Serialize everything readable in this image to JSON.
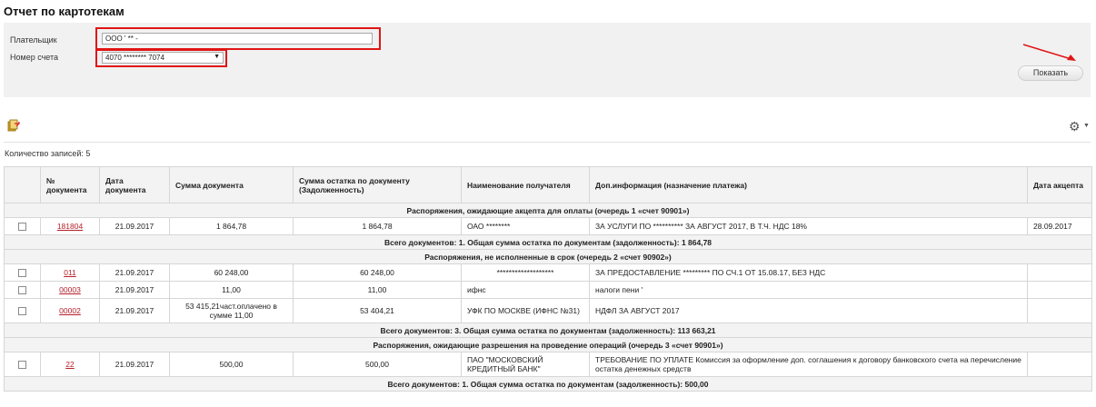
{
  "page": {
    "title": "Отчет по картотекам"
  },
  "filters": {
    "payer_label": "Плательщик",
    "payer_value": "ООО '  ** -",
    "account_label": "Номер счета",
    "account_value": "4070 ********    7074",
    "show_button": "Показать"
  },
  "toolbar": {
    "export_icon": "export-icon",
    "settings_icon": "gear-icon"
  },
  "record_count": "Количество записей: 5",
  "table": {
    "headers": [
      "",
      "№ документа",
      "Дата документа",
      "Сумма документа",
      "Сумма остатка по документу (Задолженность)",
      "Наименование получателя",
      "Доп.информация (назначение платежа)",
      "Дата акцепта"
    ],
    "groups": [
      {
        "title": "Распоряжения, ожидающие акцепта для оплаты (очередь 1 «счет 90901»)",
        "rows": [
          {
            "num": "181804",
            "date": "21.09.2017",
            "amount": "1 864,78",
            "remainder": "1 864,78",
            "recipient": "ОАО ********",
            "info": "ЗА УСЛУГИ ПО   **********  ЗА АВГУСТ 2017, В Т.Ч. НДС 18%",
            "accept_date": "28.09.2017"
          }
        ],
        "total": "Всего документов: 1. Общая сумма остатка по документам (задолженность): 1 864,78"
      },
      {
        "title": "Распоряжения, не исполненные в срок (очередь 2 «счет 90902»)",
        "rows": [
          {
            "num": "011",
            "date": "21.09.2017",
            "amount": "60 248,00",
            "remainder": "60 248,00",
            "recipient": "*******************",
            "info": "ЗА ПРЕДОСТАВЛЕНИЕ   *********   ПО СЧ.1 ОТ 15.08.17, БЕЗ НДС",
            "accept_date": ""
          },
          {
            "num": "00003",
            "date": "21.09.2017",
            "amount": "11,00",
            "remainder": "11,00",
            "recipient": "ифнс",
            "info": "налоги пени '",
            "accept_date": ""
          },
          {
            "num": "00002",
            "date": "21.09.2017",
            "amount": "53 415,21част.оплачено в сумме 11,00",
            "remainder": "53 404,21",
            "recipient": "УФК ПО МОСКВЕ (ИФНС №31)",
            "info": "НДФЛ ЗА АВГУСТ 2017",
            "accept_date": ""
          }
        ],
        "total": "Всего документов: 3. Общая сумма остатка по документам (задолженность): 113 663,21"
      },
      {
        "title": "Распоряжения, ожидающие разрешения на проведение операций (очередь 3 «счет 90901»)",
        "rows": [
          {
            "num": "22",
            "date": "21.09.2017",
            "amount": "500,00",
            "remainder": "500,00",
            "recipient": "ПАО \"МОСКОВСКИЙ КРЕДИТНЫЙ БАНК\"",
            "info": "ТРЕБОВАНИЕ ПО УПЛАТЕ Комиссия за оформление доп. соглашения к договору банковского счета на перечисление остатка денежных средств",
            "accept_date": ""
          }
        ],
        "total": "Всего документов: 1. Общая сумма остатка по документам (задолженность): 500,00"
      }
    ]
  },
  "colors": {
    "highlight": "#e01515",
    "link": "#b5202a",
    "panel": "#f1f1f1"
  }
}
